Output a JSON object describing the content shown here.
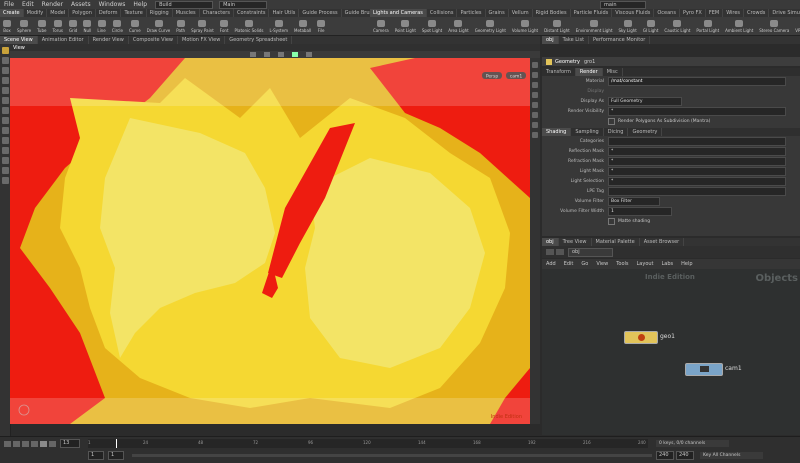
{
  "menubar": {
    "items": [
      "File",
      "Edit",
      "Render",
      "Assets",
      "Windows",
      "Help"
    ],
    "desktop": "Build",
    "context": "Main",
    "network_combo": "main"
  },
  "shelf_tabs_left": [
    "Create",
    "Modify",
    "Model",
    "Polygon",
    "Deform",
    "Texture",
    "Rigging",
    "Muscles",
    "Characters",
    "Constraints",
    "Hair Utils",
    "Guide Process",
    "Guide Brushes",
    "Terrain FX",
    "Simple FX",
    "Cloud FX",
    "Volume"
  ],
  "shelf_tabs_right": [
    "Lights and Cameras",
    "Collisions",
    "Particles",
    "Grains",
    "Vellum",
    "Rigid Bodies",
    "Particle Fluids",
    "Viscous Fluids",
    "Oceans",
    "Pyro FX",
    "FEM",
    "Wires",
    "Crowds",
    "Drive Simulation"
  ],
  "shelf_tools_left": [
    "Box",
    "Sphere",
    "Tube",
    "Torus",
    "Grid",
    "Null",
    "Line",
    "Circle",
    "Curve",
    "Draw Curve",
    "Path",
    "Spray Paint",
    "Font",
    "Platonic Solids",
    "L-System",
    "Metaball",
    "File"
  ],
  "shelf_tools_right": [
    "Camera",
    "Point Light",
    "Spot Light",
    "Area Light",
    "Geometry Light",
    "Volume Light",
    "Distant Light",
    "Environment Light",
    "Sky Light",
    "GI Light",
    "Caustic Light",
    "Portal Light",
    "Ambient Light",
    "Stereo Camera",
    "VR Camera",
    "Switcher",
    "Gamepad Camera"
  ],
  "pane_tabs_left": [
    "Scene View",
    "Animation Editor",
    "Render View",
    "Composite View",
    "Motion FX View",
    "Geometry Spreadsheet"
  ],
  "pane_tabs_right": [
    "obj",
    "Take List",
    "Performance Monitor"
  ],
  "viewport": {
    "title": "View",
    "persp": "Persp",
    "cam": "cam1",
    "watermark": "Indie Edition"
  },
  "param": {
    "node_type": "Geometry",
    "node_name": "gro1",
    "tabs": [
      "Transform",
      "Render",
      "Misc"
    ],
    "active_tab": "Render",
    "material_label": "Material",
    "material_value": "/mat/constant",
    "display_label": "Display",
    "display_as_label": "Display As",
    "display_as_value": "Full Geometry",
    "render_vis_label": "Render Visibility",
    "render_vis_value": "*",
    "render_polygons": "Render Polygons As Subdivision (Mantra)",
    "subtabs": [
      "Shading",
      "Sampling",
      "Dicing",
      "Geometry"
    ],
    "rows": [
      {
        "label": "Categories",
        "value": ""
      },
      {
        "label": "Reflection Mask",
        "value": "*"
      },
      {
        "label": "Refraction Mask",
        "value": "*"
      },
      {
        "label": "Light Mask",
        "value": "*"
      },
      {
        "label": "Light Selection",
        "value": "*"
      },
      {
        "label": "LPE Tag",
        "value": ""
      },
      {
        "label": "Volume Filter",
        "value": "Box Filter"
      },
      {
        "label": "Volume Filter Width",
        "value": "1"
      }
    ],
    "matte_shading": "Matte shading"
  },
  "network": {
    "tabs": [
      "obj",
      "Tree View",
      "Material Palette",
      "Asset Browser"
    ],
    "path": "obj",
    "menu": [
      "Add",
      "Edit",
      "Go",
      "View",
      "Tools",
      "Layout",
      "Labs",
      "Help"
    ],
    "watermark_edition": "Indie Edition",
    "watermark_context": "Objects",
    "nodes": [
      "geo1",
      "cam1"
    ]
  },
  "timeline": {
    "current_frame": "13",
    "start": "1",
    "end_a": "240",
    "end_b": "240",
    "range_start": "1",
    "range_end": "1",
    "ticks": [
      "1",
      "24",
      "48",
      "72",
      "96",
      "120",
      "144",
      "168",
      "192",
      "216",
      "240"
    ],
    "channels": "0 keys, 0/0 channels",
    "key_all": "Key All Channels",
    "auto_update": "Auto Update"
  },
  "colors": {
    "flame_red": "#ee1c10",
    "flame_yellow": "#f5d832",
    "flame_orange": "#e6b21a",
    "flame_pale": "#f3e466",
    "geo_node": "#e2c45a",
    "cam_node": "#7aa4c8"
  }
}
